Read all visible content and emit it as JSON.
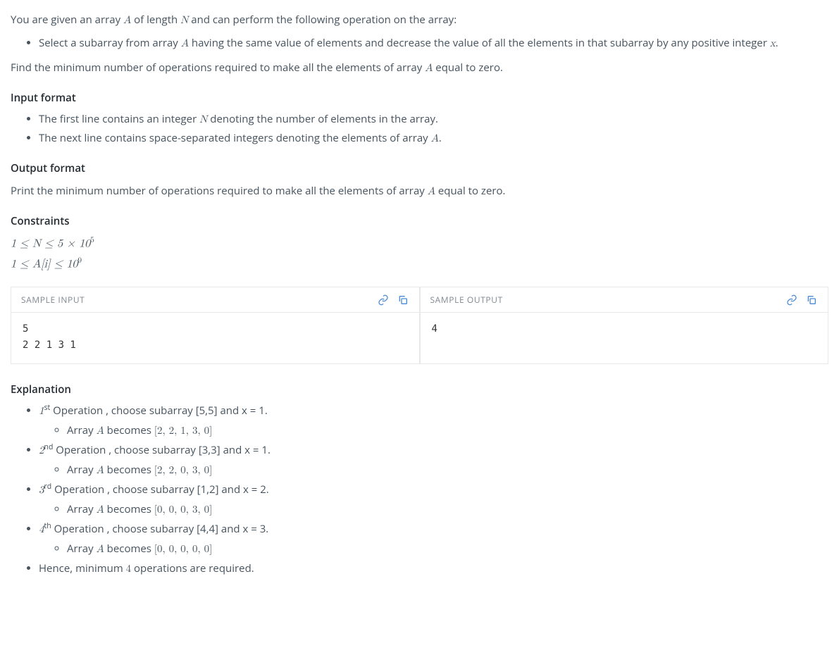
{
  "intro": {
    "line1_pre": "You are given an array ",
    "line1_A": "A",
    "line1_mid": " of length ",
    "line1_N": "N",
    "line1_post": " and can perform the following operation on the array:",
    "bullet_pre": "Select a subarray from array ",
    "bullet_A": "A",
    "bullet_mid": " having the same value of elements and decrease the value of all the elements in that subarray by any positive integer ",
    "bullet_x": "x",
    "bullet_post": ".",
    "find_pre": "Find the minimum number of operations required to make all the elements of array ",
    "find_A": "A",
    "find_post": " equal to zero."
  },
  "headings": {
    "input": "Input format",
    "output": "Output format",
    "constraints": "Constraints",
    "explanation": "Explanation"
  },
  "input_format": {
    "b1_pre": "The first line contains an integer ",
    "b1_N": "N",
    "b1_post": " denoting the number of elements in the array.",
    "b2_pre": "The next line contains space-separated integers denoting the elements of array ",
    "b2_A": "A",
    "b2_post": "."
  },
  "output_format": {
    "line_pre": "Print the minimum number of operations required to make all the elements of array ",
    "line_A": "A",
    "line_post": " equal to zero."
  },
  "constraints": {
    "c1": "1 ≤ N ≤ 5 × 10",
    "c1_sup": "5",
    "c2_pre": "1 ≤ ",
    "c2_mid": "A[i]",
    "c2_post": " ≤ 10",
    "c2_sup": "9"
  },
  "samples": {
    "input_title": "SAMPLE INPUT",
    "output_title": "SAMPLE OUTPUT",
    "input_body": "5\n2 2 1 3 1",
    "output_body": "4"
  },
  "explanation": {
    "ops": [
      {
        "ord": "1",
        "sup": "st",
        "text": " Operation , choose subarray [5,5] and x = 1.",
        "arr_label": "Array ",
        "A": "A",
        "becomes": " becomes ",
        "arr": "[2, 2, 1, 3, 0]"
      },
      {
        "ord": "2",
        "sup": "nd",
        "text": " Operation , choose subarray [3,3] and x = 1.",
        "arr_label": "Array ",
        "A": "A",
        "becomes": " becomes ",
        "arr": "[2, 2, 0, 3, 0]"
      },
      {
        "ord": "3",
        "sup": "rd",
        "text": " Operation , choose subarray [1,2] and x = 2.",
        "arr_label": "Array ",
        "A": "A",
        "becomes": " becomes ",
        "arr": "[0, 0, 0, 3, 0]"
      },
      {
        "ord": "4",
        "sup": "th",
        "text": " Operation , choose subarray [4,4] and x = 3.",
        "arr_label": "Array ",
        "A": "A",
        "becomes": " becomes ",
        "arr": "[0, 0, 0, 0, 0]"
      }
    ],
    "final_pre": "Hence, minimum ",
    "final_num": "4",
    "final_post": " operations are required."
  }
}
